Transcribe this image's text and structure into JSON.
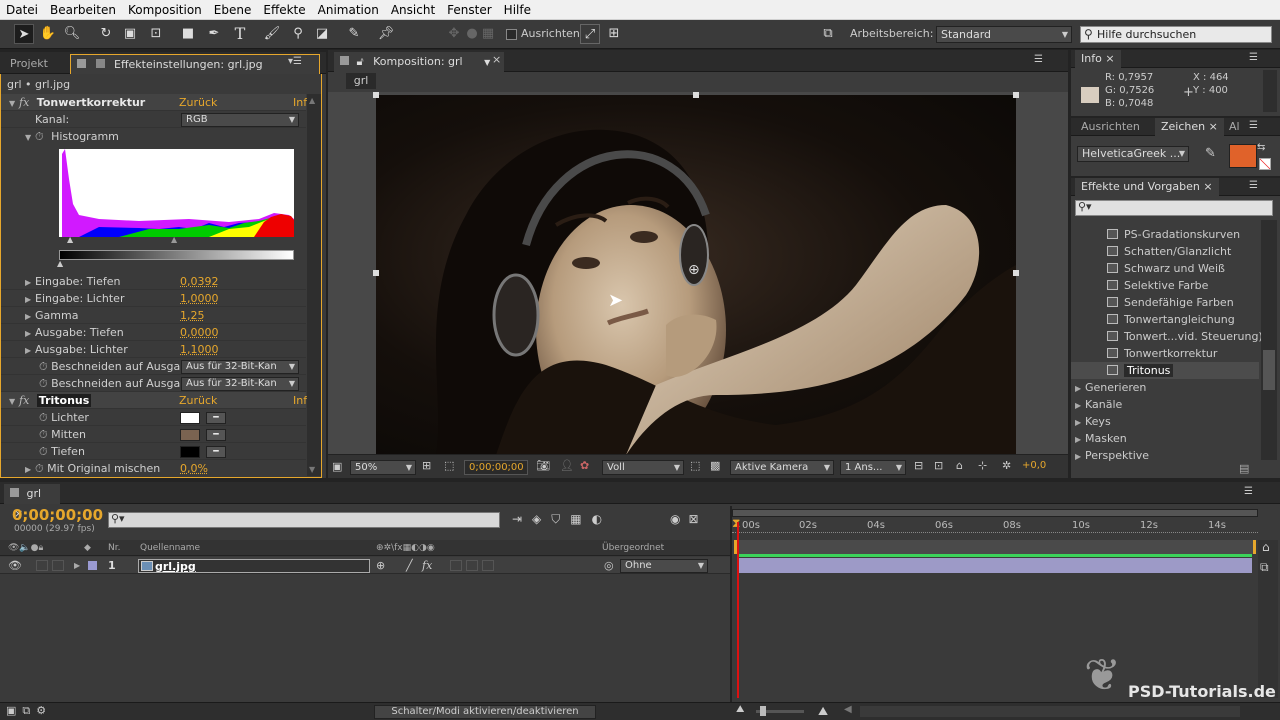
{
  "menu": [
    "Datei",
    "Bearbeiten",
    "Komposition",
    "Ebene",
    "Effekte",
    "Animation",
    "Ansicht",
    "Fenster",
    "Hilfe"
  ],
  "toolbar": {
    "align_label": "Ausrichten",
    "workspace_label": "Arbeitsbereich:",
    "workspace_value": "Standard",
    "help_search": "Hilfe durchsuchen"
  },
  "left_panel": {
    "tab_project": "Projekt",
    "tab_effects": "Effekteinstellungen: grl.jpg",
    "breadcrumb": "grl • grl.jpg",
    "effect1": {
      "name": "Tonwertkorrektur",
      "reset": "Zurück",
      "info": "Inf",
      "channel_label": "Kanal:",
      "channel_value": "RGB",
      "histogram_label": "Histogramm",
      "params": [
        {
          "label": "Eingabe: Tiefen",
          "value": "0,0392"
        },
        {
          "label": "Eingabe: Lichter",
          "value": "1,0000"
        },
        {
          "label": "Gamma",
          "value": "1,25"
        },
        {
          "label": "Ausgabe: Tiefen",
          "value": "0,0000"
        },
        {
          "label": "Ausgabe: Lichter",
          "value": "1,1000"
        }
      ],
      "clip1_label": "Beschneiden auf Ausga",
      "clip1_value": "Aus für 32-Bit-Kan",
      "clip2_label": "Beschneiden auf Ausga",
      "clip2_value": "Aus für 32-Bit-Kan"
    },
    "effect2": {
      "name": "Tritonus",
      "reset": "Zurück",
      "info": "Inf",
      "highlights": "Lichter",
      "midtones": "Mitten",
      "shadows": "Tiefen",
      "blend_label": "Mit Original mischen",
      "blend_value": "0,0%",
      "colors": {
        "highlights": "#ffffff",
        "midtones": "#7a6351",
        "shadows": "#000000"
      }
    }
  },
  "comp_panel": {
    "tab": "Komposition: grl",
    "chip": "grl",
    "zoom": "50%",
    "timecode": "0;00;00;00",
    "resolution": "Voll",
    "camera": "Aktive Kamera",
    "views": "1 Ans...",
    "exposure": "+0,0"
  },
  "info_panel": {
    "tab": "Info",
    "r": "R:  0,7957",
    "g": "G:  0,7526",
    "b": "B:  0,7048",
    "x": "X : 464",
    "y": "Y : 400",
    "swatch": "#d8cdbf"
  },
  "char_panel": {
    "tab_align": "Ausrichten",
    "tab_char": "Zeichen",
    "tab_al": "Al",
    "font": "HelveticaGreek ...",
    "fill": "#e0622a"
  },
  "effects_panel": {
    "tab": "Effekte und Vorgaben",
    "items": [
      "PS-Gradationskurven",
      "Schatten/Glanzlicht",
      "Schwarz und Weiß",
      "Selektive Farbe",
      "Sendefähige Farben",
      "Tonwertangleichung",
      "Tonwert...vid. Steuerung)",
      "Tonwertkorrektur",
      "Tritonus"
    ],
    "categories": [
      "Generieren",
      "Kanäle",
      "Keys",
      "Masken",
      "Perspektive"
    ]
  },
  "timeline": {
    "tab": "grl",
    "timecode": "0;00;00;00",
    "fps": "00000 (29.97 fps)",
    "col_nr": "Nr.",
    "col_source": "Quellenname",
    "col_parent": "Übergeordnet",
    "layer_nr": "1",
    "layer_name": "grl.jpg",
    "layer_parent": "Ohne",
    "ruler": [
      "00s",
      "02s",
      "04s",
      "06s",
      "08s",
      "10s",
      "12s",
      "14s"
    ],
    "toggle_label": "Schalter/Modi aktivieren/deaktivieren"
  },
  "watermark": "PSD-Tutorials.de"
}
